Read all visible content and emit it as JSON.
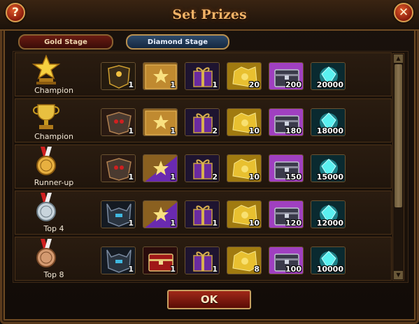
{
  "dialog": {
    "title": "Set Prizes",
    "help_label": "?",
    "close_label": "✕",
    "ok_label": "OK"
  },
  "tabs": [
    {
      "label": "Gold Stage",
      "selected": false
    },
    {
      "label": "Diamond Stage",
      "selected": true
    }
  ],
  "colors": {
    "title": "#f2b266",
    "frame_border": "#6e4a22",
    "gem": "#3ad8d0",
    "chest_purple": "#a040c0"
  },
  "rows": [
    {
      "rank": "Champion",
      "rank_icon": "gold-star-trophy-icon",
      "rewards": [
        {
          "icon": "dark-armor-icon",
          "qty": "1"
        },
        {
          "icon": "star-card-icon",
          "qty": "1"
        },
        {
          "icon": "purple-gift-box-icon",
          "qty": "1"
        },
        {
          "icon": "gold-ore-icon",
          "qty": "20"
        },
        {
          "icon": "treasure-chest-icon",
          "qty": "200"
        },
        {
          "icon": "cyan-gem-icon",
          "qty": "20000"
        }
      ]
    },
    {
      "rank": "Champion",
      "rank_icon": "gold-cup-icon",
      "rewards": [
        {
          "icon": "skull-armor-icon",
          "qty": "1"
        },
        {
          "icon": "star-card-icon",
          "qty": "1"
        },
        {
          "icon": "purple-gift-box-icon",
          "qty": "2"
        },
        {
          "icon": "gold-ore-icon",
          "qty": "10"
        },
        {
          "icon": "treasure-chest-icon",
          "qty": "180"
        },
        {
          "icon": "cyan-gem-icon",
          "qty": "18000"
        }
      ]
    },
    {
      "rank": "Runner-up",
      "rank_icon": "gold-medal-icon",
      "rewards": [
        {
          "icon": "skull-armor-icon",
          "qty": "1"
        },
        {
          "icon": "purple-star-card-icon",
          "qty": "1"
        },
        {
          "icon": "purple-gift-box-icon",
          "qty": "2"
        },
        {
          "icon": "gold-ore-icon",
          "qty": "10"
        },
        {
          "icon": "treasure-chest-icon",
          "qty": "150"
        },
        {
          "icon": "cyan-gem-icon",
          "qty": "15000"
        }
      ]
    },
    {
      "rank": "Top 4",
      "rank_icon": "silver-medal-icon",
      "rewards": [
        {
          "icon": "horned-armor-icon",
          "qty": "1"
        },
        {
          "icon": "purple-star-card-icon",
          "qty": "1"
        },
        {
          "icon": "purple-gift-box-icon",
          "qty": "1"
        },
        {
          "icon": "gold-ore-icon",
          "qty": "10"
        },
        {
          "icon": "treasure-chest-icon",
          "qty": "120"
        },
        {
          "icon": "cyan-gem-icon",
          "qty": "12000"
        }
      ]
    },
    {
      "rank": "Top 8",
      "rank_icon": "bronze-medal-icon",
      "rewards": [
        {
          "icon": "horned-armor-icon",
          "qty": "1"
        },
        {
          "icon": "red-chest-icon",
          "qty": "1"
        },
        {
          "icon": "purple-gift-box-icon",
          "qty": "1"
        },
        {
          "icon": "gold-ore-icon",
          "qty": "8"
        },
        {
          "icon": "treasure-chest-icon",
          "qty": "100"
        },
        {
          "icon": "cyan-gem-icon",
          "qty": "10000"
        }
      ]
    }
  ]
}
